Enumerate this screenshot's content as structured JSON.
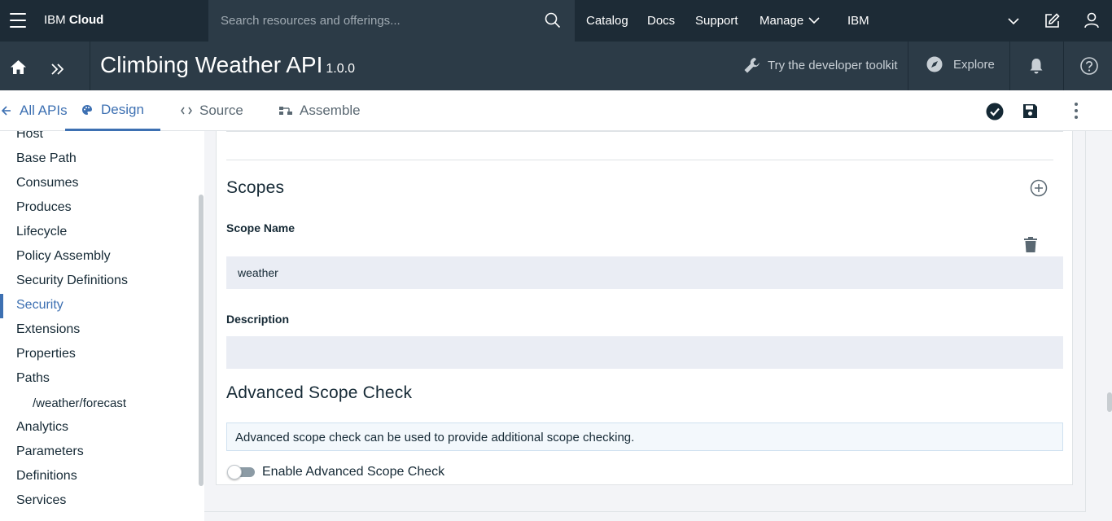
{
  "header": {
    "brand_light": "IBM",
    "brand_bold": "Cloud",
    "search_placeholder": "Search resources and offerings...",
    "nav": {
      "catalog": "Catalog",
      "docs": "Docs",
      "support": "Support",
      "manage": "Manage",
      "account": "IBM"
    },
    "icons": [
      "menu-icon",
      "search-icon",
      "chevron-down-icon",
      "edit-icon",
      "user-icon"
    ]
  },
  "subheader": {
    "title": "Climbing Weather API",
    "version": "1.0.0",
    "devkit_label": "Try the developer toolkit",
    "explore_label": "Explore",
    "icons": [
      "home-icon",
      "double-chevron-icon",
      "wrench-icon",
      "compass-icon",
      "bell-icon",
      "help-icon"
    ]
  },
  "tabs": {
    "all_apis": "All APIs",
    "design": "Design",
    "source": "Source",
    "assemble": "Assemble",
    "active": "Design"
  },
  "sidebar": {
    "items": [
      {
        "label": "Host"
      },
      {
        "label": "Base Path"
      },
      {
        "label": "Consumes"
      },
      {
        "label": "Produces"
      },
      {
        "label": "Lifecycle"
      },
      {
        "label": "Policy Assembly"
      },
      {
        "label": "Security Definitions"
      },
      {
        "label": "Security"
      },
      {
        "label": "Extensions"
      },
      {
        "label": "Properties"
      },
      {
        "label": "Paths"
      },
      {
        "label": "/weather/forecast"
      },
      {
        "label": "Analytics"
      },
      {
        "label": "Parameters"
      },
      {
        "label": "Definitions"
      },
      {
        "label": "Services"
      }
    ],
    "active": "Security"
  },
  "main": {
    "scopes_heading": "Scopes",
    "scope_name_label": "Scope Name",
    "scope_name_value": "weather",
    "description_label": "Description",
    "description_value": "",
    "advanced_heading": "Advanced Scope Check",
    "advanced_info": "Advanced scope check can be used to provide additional scope checking.",
    "toggle_label": "Enable Advanced Scope Check",
    "toggle_on": false
  },
  "colors": {
    "topbar": "#1d2b36",
    "subbar": "#2c3b47",
    "accent": "#3d70b2",
    "field_bg": "#eaedf4"
  }
}
